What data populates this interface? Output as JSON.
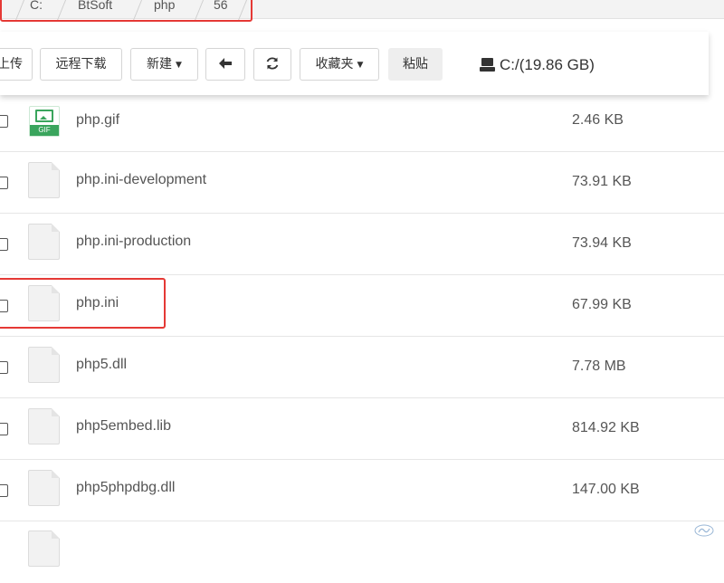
{
  "breadcrumb": {
    "items": [
      "C:",
      "BtSoft",
      "php",
      "56"
    ]
  },
  "toolbar": {
    "upload_label": "上传",
    "remote_download_label": "远程下载",
    "new_label": "新建",
    "back_icon": "arrow-left-icon",
    "refresh_icon": "refresh-icon",
    "favorites_label": "收藏夹",
    "paste_label": "粘贴",
    "disk_label": "C:/(19.86 GB)"
  },
  "files": [
    {
      "name": "php.gif",
      "size": "2.46 KB",
      "icon": "gif-image-icon"
    },
    {
      "name": "php.ini-development",
      "size": "73.91 KB",
      "icon": "file-icon"
    },
    {
      "name": "php.ini-production",
      "size": "73.94 KB",
      "icon": "file-icon"
    },
    {
      "name": "php.ini",
      "size": "67.99 KB",
      "icon": "file-icon"
    },
    {
      "name": "php5.dll",
      "size": "7.78 MB",
      "icon": "file-icon"
    },
    {
      "name": "php5embed.lib",
      "size": "814.92 KB",
      "icon": "file-icon"
    },
    {
      "name": "php5phpdbg.dll",
      "size": "147.00 KB",
      "icon": "file-icon"
    }
  ],
  "gif_badge": "GIF",
  "colors": {
    "highlight": "#e53935",
    "gif_green": "#3aa55d"
  }
}
